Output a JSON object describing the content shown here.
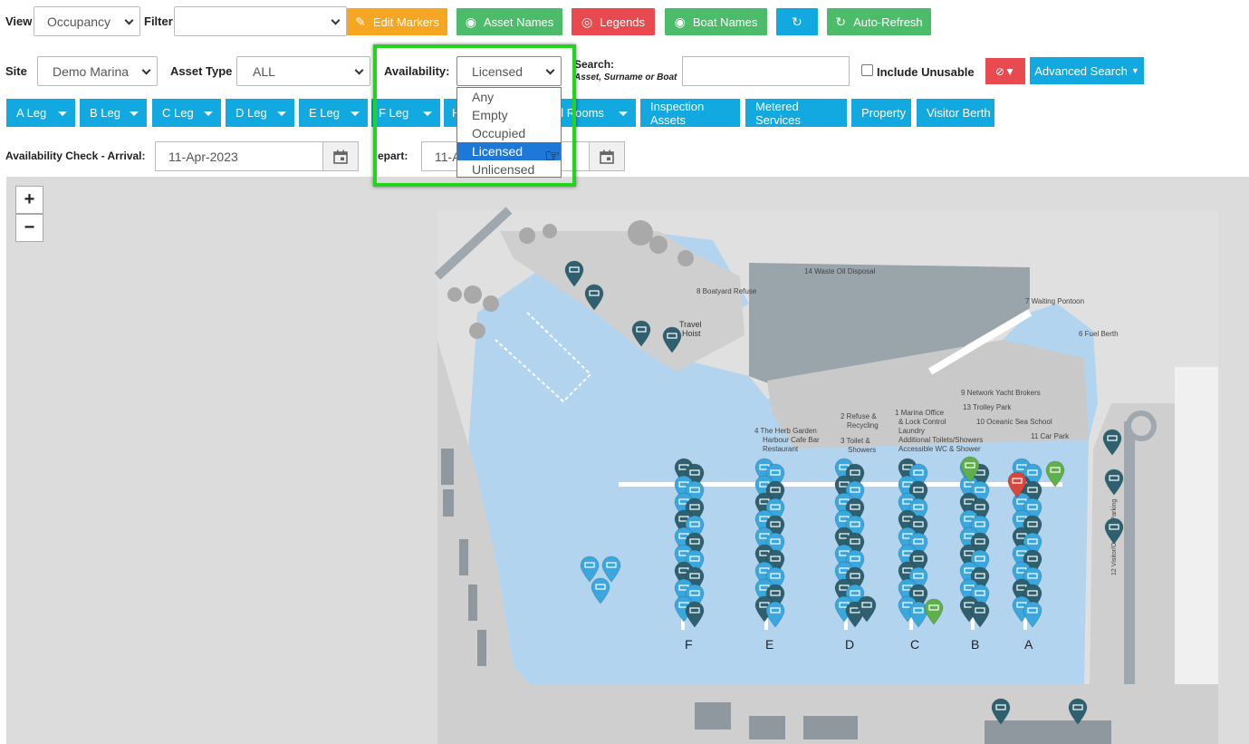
{
  "toolbar": {
    "view_label": "View",
    "view_value": "Occupancy",
    "filter_label": "Filter",
    "filter_value": "",
    "buttons": [
      {
        "label": "Edit Markers",
        "icon": "✎",
        "color": "#f5a623"
      },
      {
        "label": "Asset Names",
        "icon": "◉",
        "color": "#4cbb6a"
      },
      {
        "label": "Legends",
        "icon": "◎",
        "color": "#e84a4f"
      },
      {
        "label": "Boat Names",
        "icon": "◉",
        "color": "#4cbb6a"
      },
      {
        "label": "",
        "icon": "↻",
        "color": "#12a8e0"
      },
      {
        "label": "Auto-Refresh",
        "icon": "↻",
        "color": "#4cbb6a"
      }
    ]
  },
  "filters": {
    "site_label": "Site",
    "site_value": "Demo Marina",
    "asset_type_label": "Asset Type",
    "asset_type_value": "ALL",
    "availability_label": "Availability:",
    "availability_value": "Licensed",
    "availability_options": [
      "Any",
      "Empty",
      "Occupied",
      "Licensed",
      "Unlicensed"
    ],
    "availability_selected_index": 3,
    "search_label": "Search:",
    "search_hint": "Asset, Surname or Boat",
    "search_value": "",
    "include_unusable_label": "Include Unusable",
    "advanced_search_label": "Advanced Search"
  },
  "categories": [
    {
      "label": "A Leg",
      "dropdown": true
    },
    {
      "label": "B Leg",
      "dropdown": true
    },
    {
      "label": "C Leg",
      "dropdown": true
    },
    {
      "label": "D Leg",
      "dropdown": true
    },
    {
      "label": "E Leg",
      "dropdown": true
    },
    {
      "label": "F Leg",
      "dropdown": true
    },
    {
      "label": "H",
      "dropdown": false
    },
    {
      "label": "el Rooms",
      "dropdown": true
    },
    {
      "label": "Inspection Assets",
      "dropdown": false
    },
    {
      "label": "Metered Services",
      "dropdown": false
    },
    {
      "label": "Property",
      "dropdown": false
    },
    {
      "label": "Visitor Berth",
      "dropdown": false
    }
  ],
  "availability_check": {
    "arrival_label": "Availability Check - Arrival:",
    "arrival_value": "11-Apr-2023",
    "depart_label": "epart:",
    "depart_value": "11-A"
  },
  "map": {
    "zoom_in": "+",
    "zoom_out": "−",
    "leg_letters": [
      "F",
      "E",
      "D",
      "C",
      "B",
      "A"
    ],
    "labels": [
      "14 Waste Oil Disposal",
      "8 Boatyard Refuse",
      "7 Waiting Pontoon",
      "Travel",
      "Hoist",
      "6 Fuel Berth",
      "9 Network Yacht Brokers",
      "13 Trolley Park",
      "10 Oceanic Sea School",
      "11 Car Park",
      "1 Marina Office",
      "& Lock Control",
      "Laundry",
      "Additional Toilets/Showers",
      "Accessible WC & Shower",
      "2 Refuse &",
      "Recycling",
      "3 Toilet &",
      "Showers",
      "4  The Herb Garden",
      "Harbour Cafe Bar",
      "Restaurant",
      "12 Visitor/Overflow Parking"
    ]
  },
  "colors": {
    "brand_blue": "#12a8e0",
    "water": "#b3d4ef",
    "land": "#dcdcdc",
    "highlight": "#22d41c",
    "marker_dark": "#2e6070",
    "marker_light": "#3aa7de",
    "marker_green": "#5fb04c",
    "marker_red": "#d7473e"
  }
}
